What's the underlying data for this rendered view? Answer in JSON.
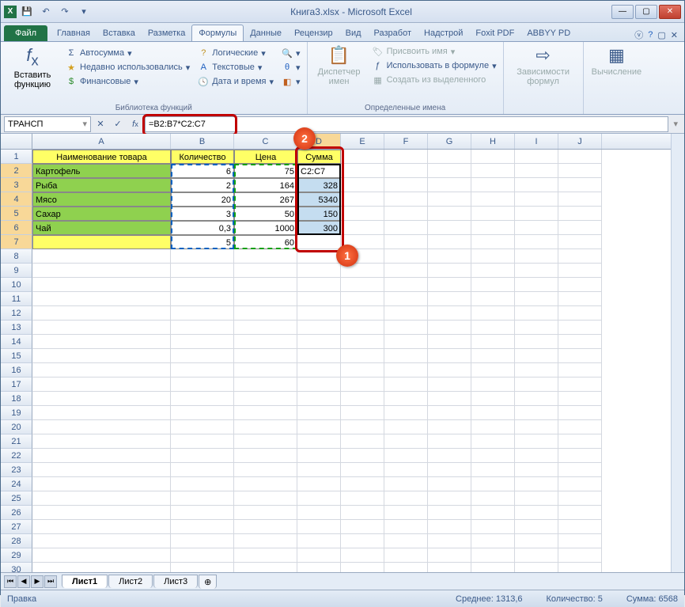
{
  "title": "Книга3.xlsx - Microsoft Excel",
  "tabs": {
    "file": "Файл",
    "list": [
      "Главная",
      "Вставка",
      "Разметка",
      "Формулы",
      "Данные",
      "Рецензир",
      "Вид",
      "Разработ",
      "Надстрой",
      "Foxit PDF",
      "ABBYY PD"
    ],
    "active": "Формулы"
  },
  "ribbon": {
    "insert_fn": "Вставить функцию",
    "autosum": "Автосумма",
    "recent": "Недавно использовались",
    "financial": "Финансовые",
    "logical": "Логические",
    "text": "Текстовые",
    "datetime": "Дата и время",
    "group1": "Библиотека функций",
    "name_mgr": "Диспетчер имен",
    "assign_name": "Присвоить имя",
    "use_in_formula": "Использовать в формуле",
    "create_from_sel": "Создать из выделенного",
    "group2": "Определенные имена",
    "deps": "Зависимости формул",
    "calc": "Вычисление"
  },
  "namebox": "ТРАНСП",
  "formula": "=B2:B7*C2:C7",
  "columns": [
    "A",
    "B",
    "C",
    "D",
    "E",
    "F",
    "G",
    "H",
    "I",
    "J"
  ],
  "headers": [
    "Наименование товара",
    "Количество",
    "Цена",
    "Сумма"
  ],
  "rows": [
    {
      "n": "Картофель",
      "q": "6",
      "p": "75",
      "s": "C2:C7"
    },
    {
      "n": "Рыба",
      "q": "2",
      "p": "164",
      "s": "328"
    },
    {
      "n": "Мясо",
      "q": "20",
      "p": "267",
      "s": "5340"
    },
    {
      "n": "Сахар",
      "q": "3",
      "p": "50",
      "s": "150"
    },
    {
      "n": "Чай",
      "q": "0,3",
      "p": "1000",
      "s": "300"
    },
    {
      "n": "",
      "q": "5",
      "p": "60",
      "s": ""
    }
  ],
  "sheets": [
    "Лист1",
    "Лист2",
    "Лист3"
  ],
  "status": {
    "mode": "Правка",
    "avg_label": "Среднее:",
    "avg": "1313,6",
    "count_label": "Количество:",
    "count": "5",
    "sum_label": "Сумма:",
    "sum": "6568"
  },
  "callouts": {
    "c1": "1",
    "c2": "2"
  }
}
